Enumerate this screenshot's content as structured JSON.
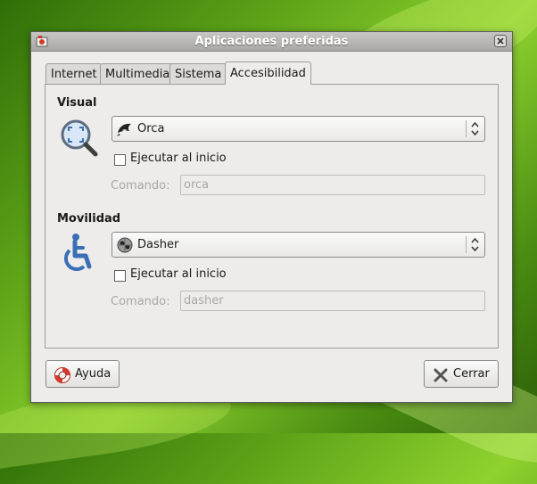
{
  "window": {
    "title": "Aplicaciones preferidas"
  },
  "tabs": [
    {
      "label": "Internet"
    },
    {
      "label": "Multimedia"
    },
    {
      "label": "Sistema"
    },
    {
      "label": "Accesibilidad",
      "active": true
    }
  ],
  "visual": {
    "title": "Visual",
    "selected": "Orca",
    "run_at_start_label": "Ejecutar al inicio",
    "run_at_start_checked": false,
    "command_label": "Comando:",
    "command_value": "orca"
  },
  "mobility": {
    "title": "Movilidad",
    "selected": "Dasher",
    "run_at_start_label": "Ejecutar al inicio",
    "run_at_start_checked": false,
    "command_label": "Comando:",
    "command_value": "dasher"
  },
  "buttons": {
    "help": "Ayuda",
    "close": "Cerrar"
  },
  "icons": {
    "window": "preferred-apps-icon",
    "visual": "magnifier-icon",
    "mobility": "wheelchair-icon",
    "orca": "orca-whale-icon",
    "dasher": "dasher-icon",
    "help": "lifebuoy-icon",
    "close": "close-x-icon"
  }
}
